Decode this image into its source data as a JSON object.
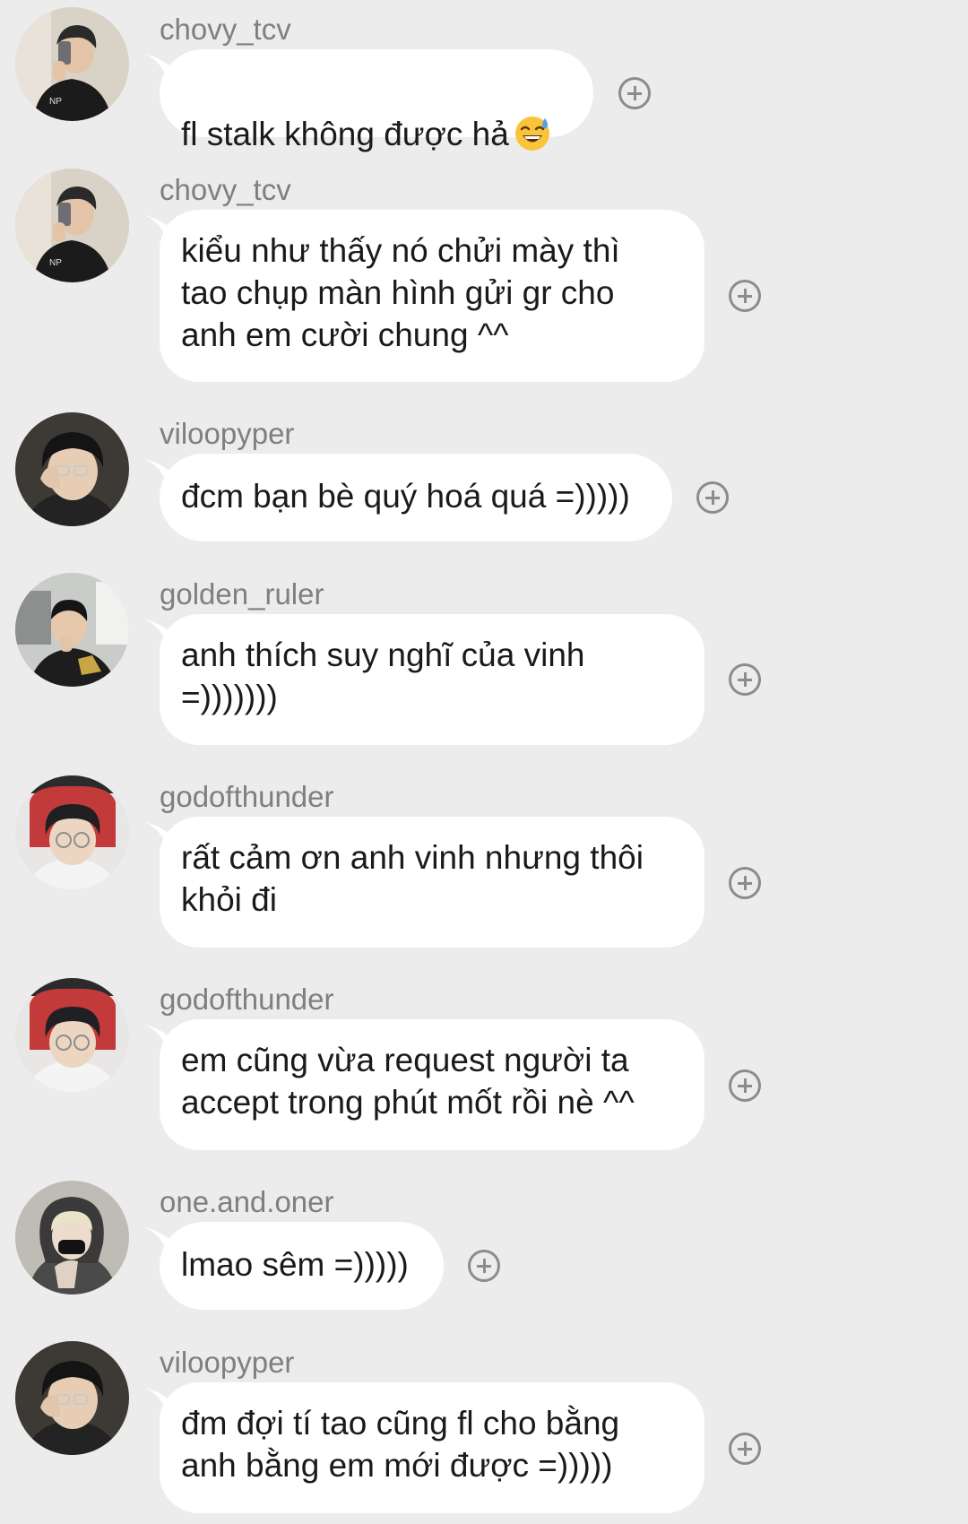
{
  "messages": [
    {
      "username": "chovy_tcv",
      "text": "fl stalk không được hả",
      "emoji": "grinning-sweat-emoji",
      "avatar": "avatar-chovy"
    },
    {
      "username": "chovy_tcv",
      "text": "kiểu như thấy nó chửi mày thì\ntao chụp màn hình gửi gr cho\nanh em cười chung ^^",
      "avatar": "avatar-chovy"
    },
    {
      "username": "viloopyper",
      "text": "đcm bạn bè quý hoá quá =)))))",
      "avatar": "avatar-viloopyper"
    },
    {
      "username": "golden_ruler",
      "text": "anh thích suy nghĩ của vinh\n=)))))))",
      "avatar": "avatar-golden-ruler"
    },
    {
      "username": "godofthunder",
      "text": "rất cảm ơn anh vinh nhưng thôi\nkhỏi đi",
      "avatar": "avatar-godofthunder"
    },
    {
      "username": "godofthunder",
      "text": "em cũng vừa request người ta\naccept trong phút mốt rồi nè ^^",
      "avatar": "avatar-godofthunder"
    },
    {
      "username": "one.and.oner",
      "text": "lmao sêm =)))))",
      "avatar": "avatar-one-and-oner"
    },
    {
      "username": "viloopyper",
      "text": "đm đợi tí tao cũng fl cho bằng\nanh bằng em mới được =)))))",
      "avatar": "avatar-viloopyper"
    }
  ],
  "icons": {
    "react": "add-reaction-icon"
  },
  "colors": {
    "background": "#ececec",
    "bubble": "#ffffff",
    "username": "#7f7f7f",
    "icon": "#8c8c8c"
  }
}
